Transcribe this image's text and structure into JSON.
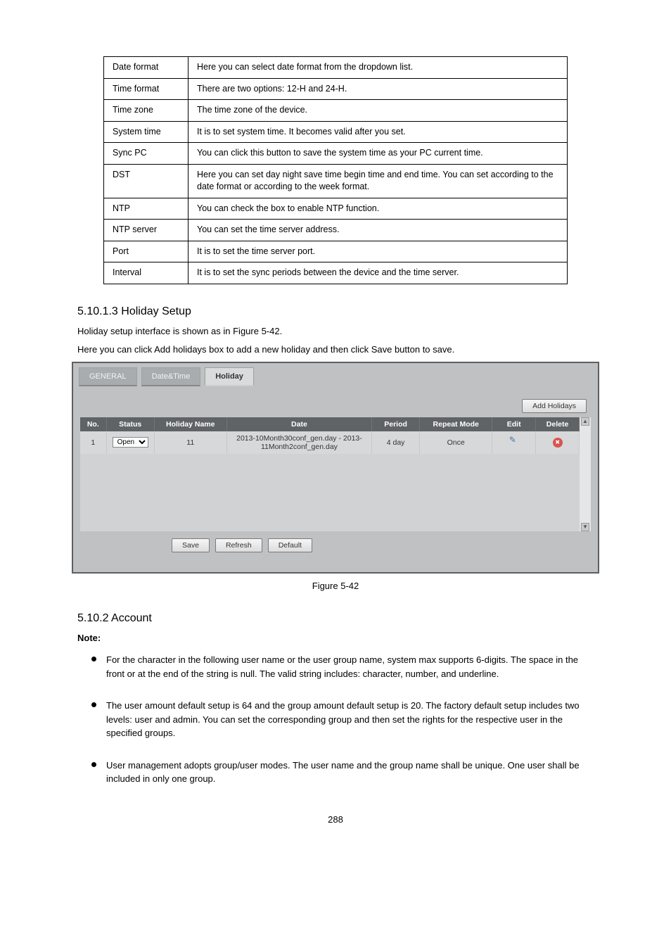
{
  "param_table": {
    "rows": [
      {
        "p": "Date format",
        "n": "Here you can select date format from the dropdown list."
      },
      {
        "p": "Time format",
        "n": "There are two options: 12-H and 24-H."
      },
      {
        "p": "Time zone",
        "n": "The time zone of the device."
      },
      {
        "p": "System time",
        "n": "It is to set system time. It becomes valid after you set."
      },
      {
        "p": "Sync PC",
        "n": "You can click this button to save the system time as your PC current time."
      },
      {
        "p": "DST",
        "n": "Here you can set day night save time begin time and end time. You can set according to the date format or according to the week format."
      },
      {
        "p": "NTP",
        "n": "You can check the box to enable NTP function."
      },
      {
        "p": "NTP server",
        "n": "You can set the time server address."
      },
      {
        "p": "Port",
        "n": "It is to set the time server port."
      },
      {
        "p": "Interval",
        "n": "It is to set the sync periods between the device and the time server."
      }
    ]
  },
  "section_heading": "5.10.1.3 Holiday Setup",
  "intro_text": "Holiday setup interface is shown as in Figure 5-42.",
  "intro_text2": "Here you can click Add holidays box to add a new holiday and then click Save button to save.",
  "panel": {
    "tabs": [
      "GENERAL",
      "Date&Time",
      "Holiday"
    ],
    "active_tab_index": 2,
    "add_btn": "Add Holidays",
    "columns": [
      "No.",
      "Status",
      "Holiday Name",
      "Date",
      "Period",
      "Repeat Mode",
      "Edit",
      "Delete"
    ],
    "rows": [
      {
        "no": "1",
        "status_value": "Open",
        "name": "11",
        "date": "2013-10Month30conf_gen.day - 2013-11Month2conf_gen.day",
        "period": "4 day",
        "repeat": "Once"
      }
    ],
    "buttons": {
      "save": "Save",
      "refresh": "Refresh",
      "default_": "Default"
    }
  },
  "figure_caption": "Figure 5-42",
  "section2_heading": "5.10.2 Account",
  "note_label": "Note:",
  "bullets": [
    "For the character in the following user name or the user group name, system max supports 6-digits. The space in the front or at the end of the string is null. The valid string includes: character, number, and underline.",
    "The user amount default setup is 64 and the group amount default setup is 20. The factory default setup includes two levels: user and admin. You can set the corresponding group and then set the rights for the respective user in the specified groups.",
    "User management adopts group/user modes. The user name and the group name shall be unique. One user shall be included in only one group."
  ],
  "page_number": "288"
}
